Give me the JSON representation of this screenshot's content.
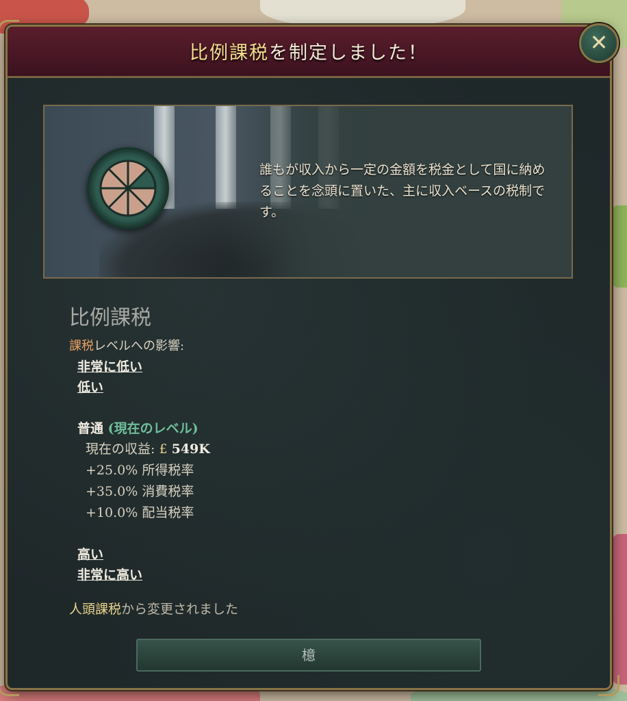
{
  "dialog": {
    "title_highlight": "比例課税",
    "title_rest": "を制定しました！",
    "close_label": "✕",
    "description": "誰もが収入から一定の金額を税金として国に納めることを念頭に置いた、主に収入ベースの税制です。",
    "heading": "比例課税",
    "effect_label_highlight": "課税",
    "effect_label_rest": "レベルへの影響:",
    "levels": {
      "very_low": "非常に低い",
      "low": "低い",
      "normal": "普通",
      "current_tag": "(現在のレベル)",
      "high": "高い",
      "very_high": "非常に高い"
    },
    "current_revenue": {
      "label": "現在の収益:",
      "currency": "£",
      "value": "549K"
    },
    "modifiers": [
      {
        "value": "+25.0%",
        "label": "所得税率"
      },
      {
        "value": "+35.0%",
        "label": "消費税率"
      },
      {
        "value": "+10.0%",
        "label": "配当税率"
      }
    ],
    "changed_from_highlight": "人頭課税",
    "changed_from_rest": "から変更されました",
    "ok_button": "檍"
  },
  "colors": {
    "title_bar": "#4a1826",
    "accent_gold": "#e9d38c",
    "current_level": "#6fbf9a",
    "tax_highlight": "#e6a064"
  }
}
